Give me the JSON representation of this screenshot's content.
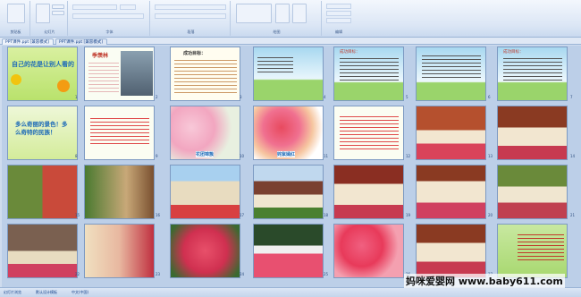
{
  "ribbon": {
    "groups": [
      "剪贴板",
      "幻灯片",
      "字体",
      "段落",
      "绘图",
      "编辑"
    ],
    "labels": [
      "粘贴",
      "新建",
      "查找",
      "替换",
      "选择"
    ]
  },
  "tabs": [
    "PPT课件.ppt [兼容模式]",
    "PPT课件.ppt [兼容模式]"
  ],
  "slides": [
    {
      "n": "1",
      "title": "自己的花是让别人看的"
    },
    {
      "n": "2",
      "title": "季羡林"
    },
    {
      "n": "3",
      "title": "成功目标："
    },
    {
      "n": "4",
      "title": ""
    },
    {
      "n": "5",
      "title": "成功目标："
    },
    {
      "n": "6",
      "title": ""
    },
    {
      "n": "7",
      "title": "成功目标："
    },
    {
      "n": "8",
      "title": "多么奇丽的景色！多么奇特的民族！"
    },
    {
      "n": "9",
      "title": ""
    },
    {
      "n": "10",
      "title": "花团锦簇"
    },
    {
      "n": "11",
      "title": "姹紫嫣红"
    },
    {
      "n": "12",
      "title": ""
    },
    {
      "n": "13",
      "title": ""
    },
    {
      "n": "14",
      "title": ""
    },
    {
      "n": "15",
      "title": ""
    },
    {
      "n": "16",
      "title": ""
    },
    {
      "n": "17",
      "title": ""
    },
    {
      "n": "18",
      "title": ""
    },
    {
      "n": "19",
      "title": ""
    },
    {
      "n": "20",
      "title": ""
    },
    {
      "n": "21",
      "title": ""
    },
    {
      "n": "22",
      "title": ""
    },
    {
      "n": "23",
      "title": ""
    },
    {
      "n": "24",
      "title": ""
    },
    {
      "n": "25",
      "title": ""
    },
    {
      "n": "26",
      "title": ""
    },
    {
      "n": "27",
      "title": ""
    }
  ],
  "status": {
    "left": "幻灯片浏览",
    "theme": "默认设计模板",
    "lang": "中文(中国)"
  },
  "watermark": "妈咪爱婴网 www.baby611.com"
}
